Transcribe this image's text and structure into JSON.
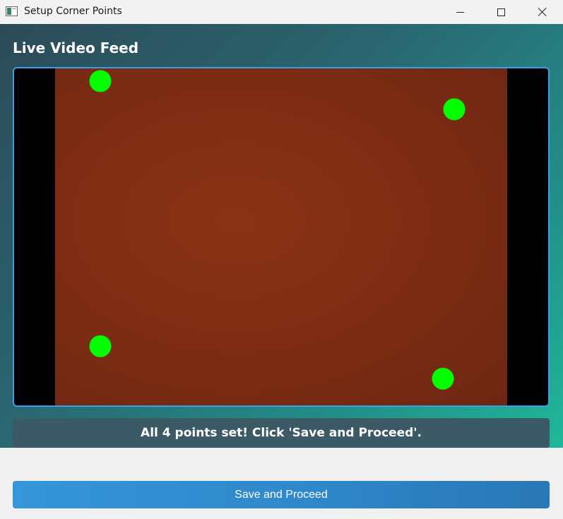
{
  "window": {
    "title": "Setup Corner Points",
    "icon": "app-window-icon",
    "controls": [
      "minimize-icon",
      "maximize-icon",
      "close-icon"
    ]
  },
  "main": {
    "section_title": "Live Video Feed",
    "video": {
      "corner_points": [
        {
          "label": "point-1"
        },
        {
          "label": "point-2"
        },
        {
          "label": "point-3"
        },
        {
          "label": "point-4"
        }
      ],
      "point_color": "#00ff00",
      "frame_border_color": "#3a9ee8"
    },
    "status_text": "All 4 points set! Click 'Save and Proceed'."
  },
  "footer": {
    "save_label": "Save and Proceed"
  },
  "colors": {
    "accent": "#2e86c8",
    "panel_gradient_start": "#2c4a58",
    "panel_gradient_end": "#1fb899"
  }
}
